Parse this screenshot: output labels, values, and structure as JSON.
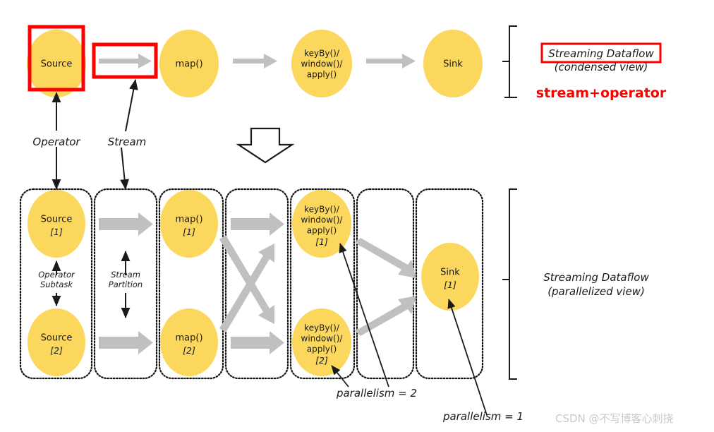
{
  "diagram": {
    "title": "Flink Streaming Dataflow: condensed vs parallelized view",
    "colors": {
      "node_fill": "#FBD75E",
      "arrow_gray": "#C0C0C0",
      "highlight_red": "#FF0000",
      "stroke_black": "#1a1a1a",
      "watermark_gray": "#c9c9c9"
    }
  },
  "condensed": {
    "nodes": [
      {
        "id": "source",
        "label": "Source",
        "lines": [
          "Source"
        ]
      },
      {
        "id": "map",
        "label": "map()",
        "lines": [
          "map()"
        ]
      },
      {
        "id": "keyby",
        "label": "keyBy()/window()/apply()",
        "lines": [
          "keyBy()/",
          "window()/",
          "apply()"
        ]
      },
      {
        "id": "sink",
        "label": "Sink",
        "lines": [
          "Sink"
        ]
      }
    ],
    "bracket_label_line1": "Streaming Dataflow",
    "bracket_label_line2": "(condensed view)",
    "red_note": "stream+operator"
  },
  "callouts": {
    "operator": "Operator",
    "stream": "Stream",
    "operator_subtask_line1": "Operator",
    "operator_subtask_line2": "Subtask",
    "stream_partition_line1": "Stream",
    "stream_partition_line2": "Partition",
    "parallelism_two": "parallelism = 2",
    "parallelism_one": "parallelism = 1"
  },
  "parallel": {
    "bracket_label_line1": "Streaming Dataflow",
    "bracket_label_line2": "(parallelized view)",
    "nodes": [
      {
        "id": "source-1",
        "lines": [
          "Source"
        ],
        "index": "[1]"
      },
      {
        "id": "source-2",
        "lines": [
          "Source"
        ],
        "index": "[2]"
      },
      {
        "id": "map-1",
        "lines": [
          "map()"
        ],
        "index": "[1]"
      },
      {
        "id": "map-2",
        "lines": [
          "map()"
        ],
        "index": "[2]"
      },
      {
        "id": "keyby-1",
        "lines": [
          "keyBy()/",
          "window()/",
          "apply()"
        ],
        "index": "[1]"
      },
      {
        "id": "keyby-2",
        "lines": [
          "keyBy()/",
          "window()/",
          "apply()"
        ],
        "index": "[2]"
      },
      {
        "id": "sink-1",
        "lines": [
          "Sink"
        ],
        "index": "[1]"
      }
    ]
  },
  "watermark": {
    "text": "CSDN @不写博客心刺挠"
  }
}
